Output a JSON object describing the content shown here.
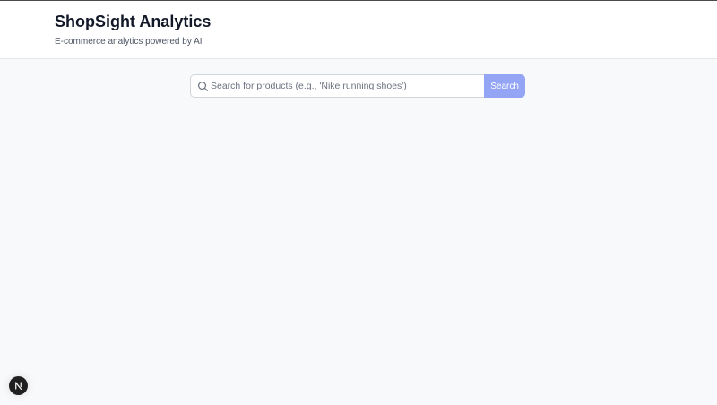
{
  "header": {
    "title": "ShopSight Analytics",
    "subtitle": "E-commerce analytics powered by AI"
  },
  "search": {
    "placeholder": "Search for products (e.g., 'Nike running shoes')",
    "value": "",
    "button_label": "Search",
    "icon": "search-icon"
  },
  "devtools": {
    "icon": "nextjs-logo-icon"
  },
  "colors": {
    "header_bg": "#ffffff",
    "page_bg": "#f8f9fb",
    "accent": "#93a5f4",
    "title_text": "#111827",
    "badge_bg": "#1f1f1f"
  }
}
